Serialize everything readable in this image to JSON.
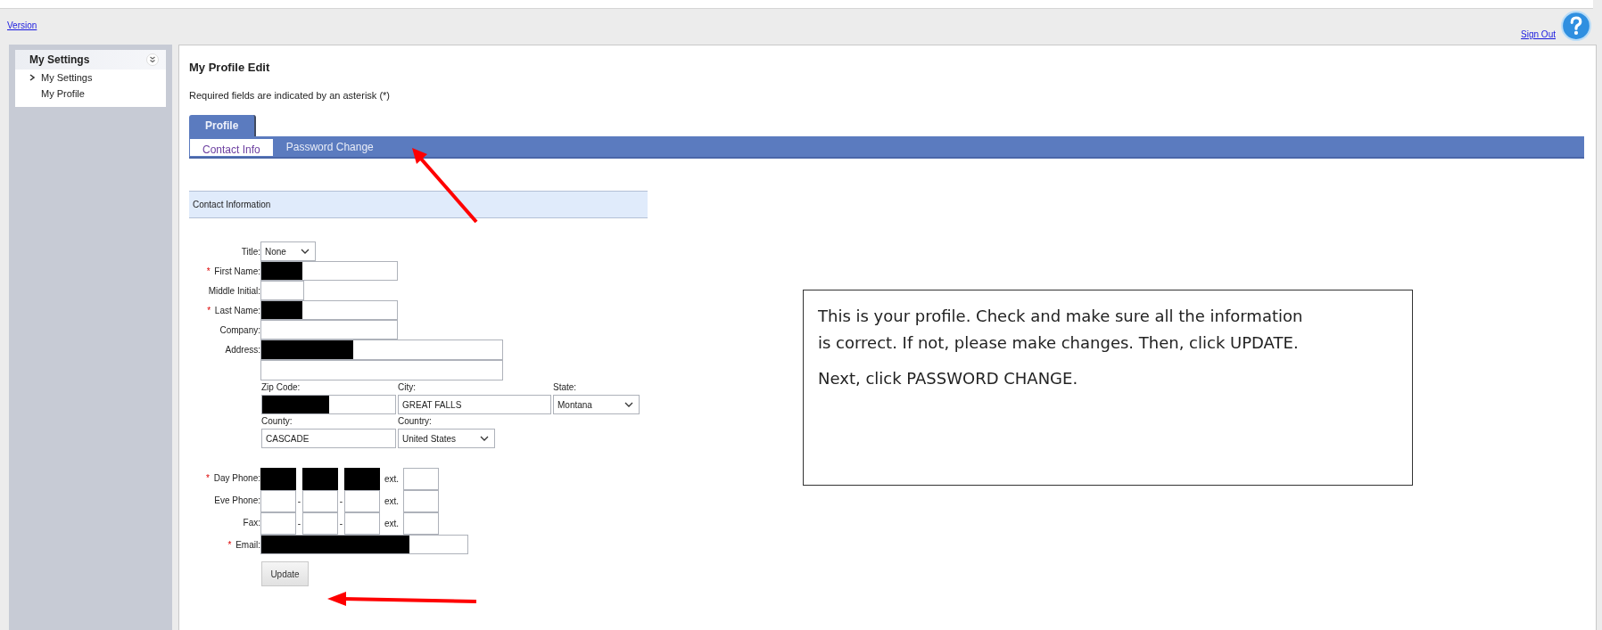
{
  "top_bar": {
    "version_link": "Version",
    "sign_out_link": "Sign Out"
  },
  "sidebar": {
    "title": "My Settings",
    "items": [
      {
        "label": "My Settings",
        "selected": true
      },
      {
        "label": "My Profile",
        "selected": false
      }
    ]
  },
  "page": {
    "title": "My Profile Edit",
    "note": "Required fields are indicated by an asterisk (*)"
  },
  "tabs": [
    {
      "label": "Profile",
      "selected": true
    }
  ],
  "subtabs": [
    {
      "label": "Contact Info",
      "selected": true
    },
    {
      "label": "Password Change",
      "selected": false
    }
  ],
  "section_title": "Contact Information",
  "form": [
    {
      "kind": "select",
      "label": "Title:",
      "value": "None"
    },
    {
      "kind": "text",
      "label": "First Name:",
      "required_mark": "*",
      "redacted": true
    },
    {
      "kind": "short",
      "label": "Middle Initial:"
    },
    {
      "kind": "text",
      "label": "Last Name:",
      "required_mark": "*",
      "redacted": true
    },
    {
      "kind": "text",
      "label": "Company:"
    },
    {
      "kind": "address",
      "label": "Address:",
      "redacted": true
    },
    {
      "kind": "location",
      "fields": [
        {
          "kind": "text",
          "label": "Zip Code:",
          "redacted": true
        },
        {
          "kind": "text",
          "label": "City:",
          "value": "GREAT FALLS"
        },
        {
          "kind": "select",
          "label": "State:",
          "value": "Montana"
        },
        {
          "kind": "text",
          "label": "County:",
          "value": "CASCADE"
        },
        {
          "kind": "select",
          "label": "Country:",
          "value": "United States"
        }
      ]
    },
    {
      "kind": "phone",
      "label": "Day Phone:",
      "required_mark": "*",
      "redacted": true,
      "ext_label": "ext."
    },
    {
      "kind": "phone",
      "label": "Eve Phone:",
      "redacted": false,
      "separator": "-",
      "ext_label": "ext."
    },
    {
      "kind": "phone",
      "label": "Fax:",
      "redacted": false,
      "separator": "-",
      "ext_label": "ext."
    },
    {
      "kind": "email",
      "label": "Email:",
      "required_mark": "*",
      "redacted": true
    }
  ],
  "update_button": "Update",
  "callout": {
    "paragraphs": [
      "This is your profile. Check and make sure all the information is correct. If not, please make changes. Then, click UPDATE.",
      "Next, click PASSWORD CHANGE."
    ]
  }
}
